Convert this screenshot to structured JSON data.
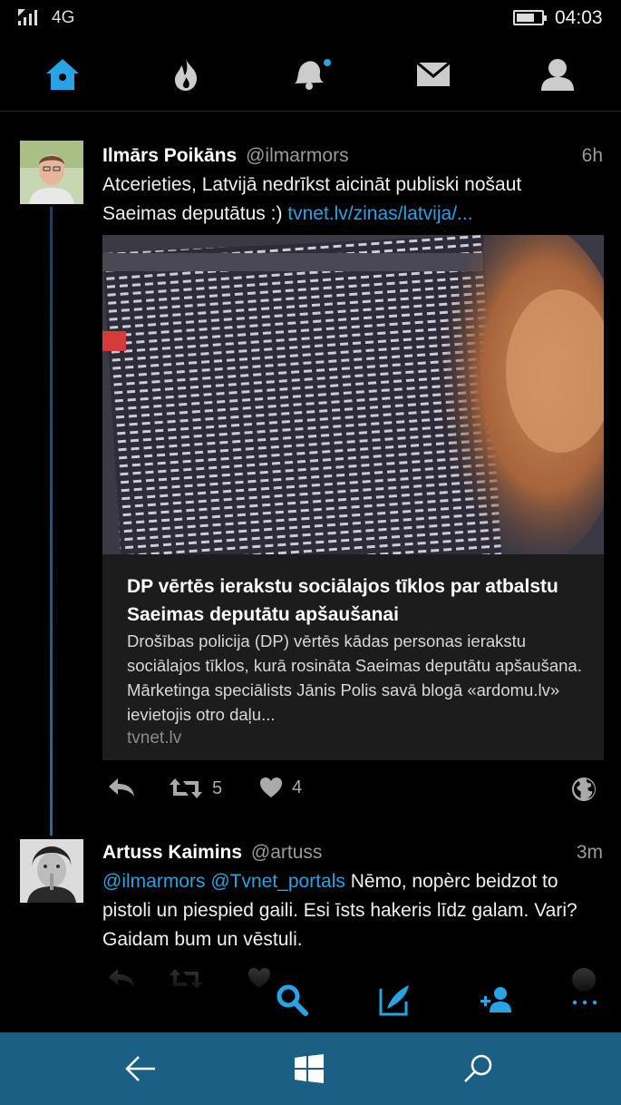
{
  "status_bar": {
    "network": "4G",
    "time": "04:03",
    "battery_level": 0.72
  },
  "top_nav": {
    "items": [
      {
        "icon": "home-icon",
        "active": true
      },
      {
        "icon": "fire-icon",
        "active": false
      },
      {
        "icon": "bell-icon",
        "active": false,
        "has_notification_dot": true
      },
      {
        "icon": "mail-icon",
        "active": false
      },
      {
        "icon": "profile-icon",
        "active": false
      }
    ]
  },
  "colors": {
    "accent": "#27a3e6",
    "background": "#000000",
    "system_nav": "#1c5f84",
    "card": "#1c1c1c"
  },
  "tweets": [
    {
      "name": "Ilmārs Poikāns",
      "handle": "@ilmarmors",
      "time": "6h",
      "text": "Atcerieties, Latvijā nedrīkst aicināt publiski nošaut Saeimas deputātus :) ",
      "link": "tvnet.lv/zinas/latvija/...",
      "card": {
        "title": "DP vērtēs ierakstu sociālajos tīklos par atbalstu Saeimas deputātu apšaušanai",
        "description": "Drošības policija (DP) vērtēs kādas personas ierakstu sociālajos tīklos, kurā rosināta Saeimas deputātu apšaušana. Mārketinga speciālists Jānis Polis savā blogā «ardomu.lv» ievietojis otro daļu...",
        "domain": "tvnet.lv"
      },
      "retweets": "5",
      "likes": "4"
    },
    {
      "name": "Artuss Kaimins",
      "handle": "@artuss",
      "time": "3m",
      "mention1": "@ilmarmors",
      "mention2": "@Tvnet_portals",
      "text": " Nēmo, nopèrc beidzot to pistoli un piespied gaili. Esi īsts hakeris līdz galam. Vari? Gaidam bum un vēstuli."
    }
  ],
  "app_bar": {
    "items": [
      "search-icon",
      "compose-icon",
      "add-user-icon",
      "more-icon"
    ]
  },
  "system_nav": {
    "items": [
      "back-icon",
      "windows-icon",
      "search-icon"
    ]
  }
}
